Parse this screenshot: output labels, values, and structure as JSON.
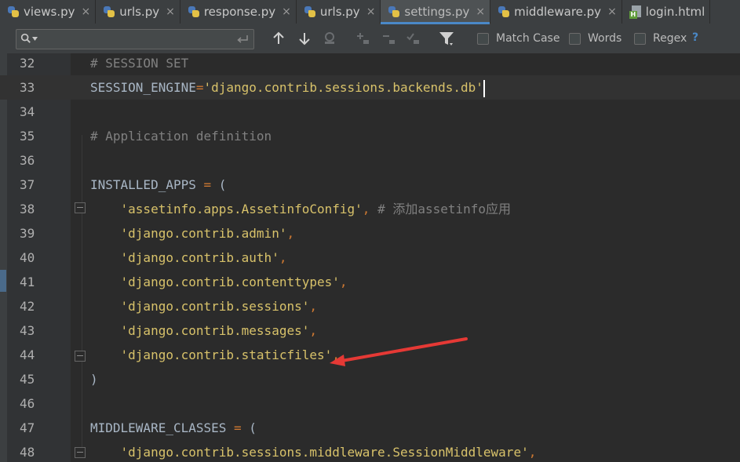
{
  "tabs": [
    {
      "label": "views.py",
      "icon": "python-file-icon",
      "active": false
    },
    {
      "label": "urls.py",
      "icon": "python-file-icon",
      "active": false
    },
    {
      "label": "response.py",
      "icon": "python-file-icon",
      "active": false
    },
    {
      "label": "urls.py",
      "icon": "python-file-icon",
      "active": false
    },
    {
      "label": "settings.py",
      "icon": "python-file-icon",
      "active": true
    },
    {
      "label": "middleware.py",
      "icon": "python-file-icon",
      "active": false
    },
    {
      "label": "login.html",
      "icon": "html-file-icon",
      "active": false
    }
  ],
  "tab_close_glyph": "×",
  "find": {
    "query": "",
    "options": {
      "match_case": {
        "label": "Match Case",
        "checked": false
      },
      "words": {
        "label": "Words",
        "checked": false
      },
      "regex": {
        "label": "Regex",
        "checked": false
      }
    },
    "help": "?"
  },
  "editor": {
    "current_line": 33,
    "lines": [
      {
        "n": "32",
        "text": "# SESSION SET"
      },
      {
        "n": "33",
        "text": "SESSION_ENGINE='django.contrib.sessions.backends.db'"
      },
      {
        "n": "34",
        "text": ""
      },
      {
        "n": "35",
        "text": "# Application definition"
      },
      {
        "n": "36",
        "text": ""
      },
      {
        "n": "37",
        "text": "INSTALLED_APPS = ("
      },
      {
        "n": "38",
        "text": "    'assetinfo.apps.AssetinfoConfig', # 添加assetinfo应用"
      },
      {
        "n": "39",
        "text": "    'django.contrib.admin',"
      },
      {
        "n": "40",
        "text": "    'django.contrib.auth',"
      },
      {
        "n": "41",
        "text": "    'django.contrib.contenttypes',"
      },
      {
        "n": "42",
        "text": "    'django.contrib.sessions',"
      },
      {
        "n": "43",
        "text": "    'django.contrib.messages',"
      },
      {
        "n": "44",
        "text": "    'django.contrib.staticfiles',"
      },
      {
        "n": "45",
        "text": ")"
      },
      {
        "n": "46",
        "text": ""
      },
      {
        "n": "47",
        "text": "MIDDLEWARE_CLASSES = ("
      },
      {
        "n": "48",
        "text": "    'django.contrib.sessions.middleware.SessionMiddleware',"
      }
    ]
  },
  "colors": {
    "comment": "#808080",
    "string": "#d8c26a",
    "operator": "#cc7832",
    "arrow": "#e53935",
    "accent": "#4a88c7"
  }
}
